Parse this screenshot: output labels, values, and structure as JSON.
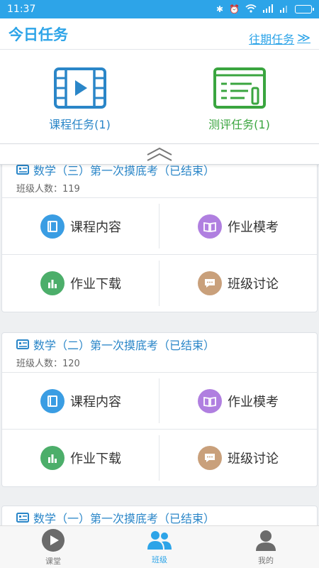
{
  "status": {
    "time": "11:37"
  },
  "header": {
    "title": "今日任务",
    "history_link": "往期任务"
  },
  "tasks": [
    {
      "label": "课程任务(1)",
      "icon": "film-play-icon",
      "color": "#2a86c8"
    },
    {
      "label": "测评任务(1)",
      "icon": "quiz-sheet-icon",
      "color": "#3aa53f"
    }
  ],
  "classes": [
    {
      "title": "数学（三）第一次摸底考（已结束）",
      "count": "班级人数：119",
      "actions": [
        "课程内容",
        "作业模考",
        "作业下载",
        "班级讨论"
      ]
    },
    {
      "title": "数学（二）第一次摸底考（已结束）",
      "count": "班级人数：120",
      "actions": [
        "课程内容",
        "作业模考",
        "作业下载",
        "班级讨论"
      ]
    },
    {
      "title": "数学（一）第一次摸底考（已结束）"
    }
  ],
  "bottom_nav": [
    {
      "label": "课堂",
      "icon": "play-circle-icon"
    },
    {
      "label": "班级",
      "icon": "group-icon",
      "active": true
    },
    {
      "label": "我的",
      "icon": "person-icon"
    }
  ],
  "colors": {
    "brand": "#2da4e8",
    "green": "#3aa53f",
    "content": "#3a9de3",
    "exam": "#b07fe0",
    "download": "#4cae6a",
    "discuss": "#c9a07b"
  }
}
